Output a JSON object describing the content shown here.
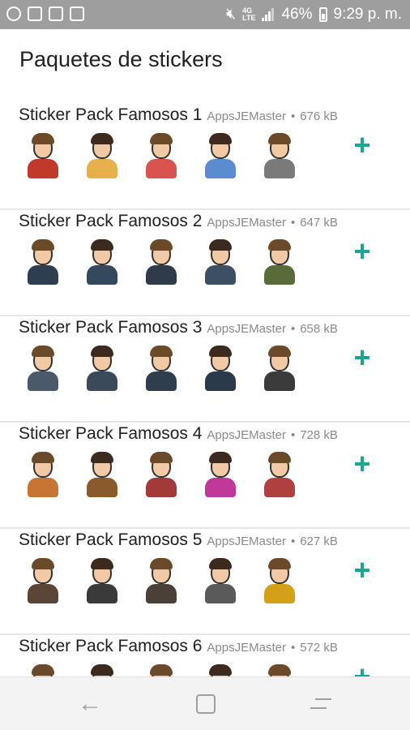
{
  "status_bar": {
    "battery": "46%",
    "time": "9:29 p. m.",
    "network": "4G",
    "network_sub": "LTE",
    "icons": [
      "pinterest-icon",
      "wifi-icon",
      "translate-icon",
      "gallery-icon",
      "mute-icon",
      "signal-icon",
      "battery-icon"
    ]
  },
  "header": {
    "title": "Paquetes de stickers"
  },
  "packs": [
    {
      "name": "Sticker Pack Famosos 1",
      "publisher": "AppsJEMaster",
      "size": "676 kB",
      "stickers": 5
    },
    {
      "name": "Sticker Pack Famosos 2",
      "publisher": "AppsJEMaster",
      "size": "647 kB",
      "stickers": 5
    },
    {
      "name": "Sticker Pack Famosos 3",
      "publisher": "AppsJEMaster",
      "size": "658 kB",
      "stickers": 5
    },
    {
      "name": "Sticker Pack Famosos 4",
      "publisher": "AppsJEMaster",
      "size": "728 kB",
      "stickers": 5
    },
    {
      "name": "Sticker Pack Famosos 5",
      "publisher": "AppsJEMaster",
      "size": "627 kB",
      "stickers": 5
    },
    {
      "name": "Sticker Pack Famosos 6",
      "publisher": "AppsJEMaster",
      "size": "572 kB",
      "stickers": 5
    }
  ],
  "add_label": "+",
  "separator": "•",
  "nav": {
    "back_icon": "back-icon",
    "home_icon": "home-icon",
    "recent_icon": "recent-apps-icon"
  },
  "colors": {
    "accent": "#1aa690",
    "status_bar": "#9e9e9e"
  }
}
